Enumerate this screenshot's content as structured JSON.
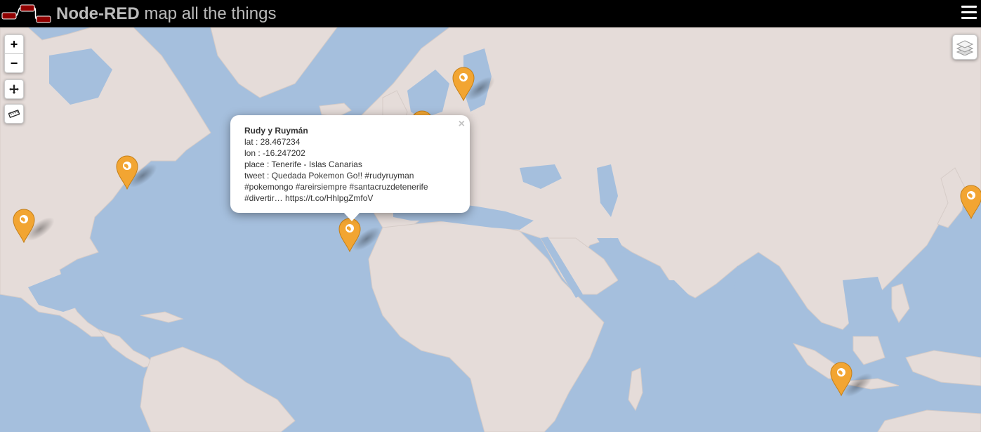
{
  "header": {
    "brand": "Node-RED",
    "subtitle": "map all the things"
  },
  "controls": {
    "zoom_in": "+",
    "zoom_out": "−"
  },
  "popup": {
    "name": "Rudy y Ruymán",
    "lines": [
      "lat : 28.467234",
      "lon : -16.247202",
      "place : Tenerife - Islas Canarias",
      "tweet : Quedada Pokemon Go!! #rudyruyman",
      "#pokemongo #areirsiempre #santacruzdetenerife",
      "#divertir… https://t.co/HhlpgZmfoV"
    ],
    "close": "×"
  },
  "colors": {
    "water": "#a5bfdd",
    "land": "#e5dcd9",
    "marker": "#f2a532",
    "header_bg": "#000000"
  },
  "icons": {
    "menu": "hamburger-menu-icon",
    "locate": "crosshair-icon",
    "measure": "ruler-icon",
    "layers": "layers-icon",
    "marker": "globe-icon"
  }
}
